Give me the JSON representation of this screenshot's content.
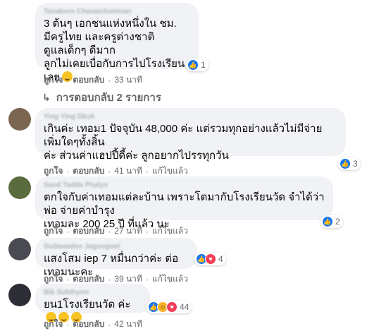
{
  "comments": [
    {
      "author": "Tanakorn Chaowchomnan",
      "text": "3 ต้นๆ เอกชนแห่งหนึ่งใน ชม.\nมีครูไทย และครูต่างชาติ\nดูแลเด็กๆ ดีมาก\nลูกไม่เคยเบื่อกับการไปโรงเรียนเลย",
      "reaction_count": "1",
      "like_label": "ถูกใจ",
      "reply_label": "ตอบกลับ",
      "time": "33 นาที"
    },
    {
      "author": "Ying Ying Dkuk",
      "text": "เกินค่ะ เทอม1 ปัจจุบัน 48,000 ค่ะ แต่รวมทุกอย่างแล้วไม่มีจ่ายเพิ่มใดๆทั้งสิ้น\nค่ะ ส่วนค่าแฮปปี้ดี้ค่ะ ลูกอยากไปรรทุกวัน",
      "reaction_count": "3",
      "like_label": "ถูกใจ",
      "reply_label": "ตอบกลับ",
      "time": "41 นาที",
      "edited": "แก้ไขแล้ว"
    },
    {
      "author": "Sand Tadda Phalyo",
      "text": "ตกใจกับค่าเทอมแต่ละบ้าน เพราะโตมากับโรงเรียนวัด จำได้ว่าพ่อ จ่ายค่าบำรุง\nเทอมละ 200 25 ปี ที่แล้ว นะ",
      "reaction_count": "2",
      "like_label": "ถูกใจ",
      "reply_label": "ตอบกลับ",
      "time": "27 นาที",
      "edited": "แก้ไขแล้ว"
    },
    {
      "author": "Sudawadee Jagongnet",
      "text": "แสงโสม iep 7 หมื่นกว่าค่ะ ต่อเทอมนะคะ",
      "reaction_count": "4",
      "like_label": "ถูกใจ",
      "reply_label": "ตอบกลับ",
      "time": "39 นาที",
      "edited": "แก้ไขแล้ว"
    },
    {
      "author": "Bik Sukthyon",
      "text": "ยน1โรงเรียนวัด ค่ะ",
      "reaction_count": "44",
      "like_label": "ถูกใจ",
      "reply_label": "ตอบกลับ",
      "time": "42 นาที"
    }
  ],
  "replies_link": "การตอบกลับ 2 รายการ",
  "reaction_icons": [
    "like-icon",
    "love-icon",
    "haha-icon"
  ],
  "colors": {
    "like": "#1877f2",
    "love": "#f33e58",
    "haha": "#f7b125",
    "bubble": "#f0f2f5",
    "meta": "#65676b"
  }
}
